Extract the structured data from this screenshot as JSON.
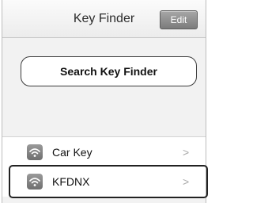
{
  "navbar": {
    "title": "Key Finder",
    "edit_label": "Edit"
  },
  "search": {
    "label": "Search Key Finder"
  },
  "devices": [
    {
      "label": "Car Key",
      "chevron": ">",
      "icon": "wifi-icon"
    },
    {
      "label": "KFDNX",
      "chevron": ">",
      "icon": "wifi-icon"
    }
  ],
  "colors": {
    "edit_button": "#8e8e8e",
    "icon_badge": "#808080",
    "highlight_border": "#222222"
  }
}
